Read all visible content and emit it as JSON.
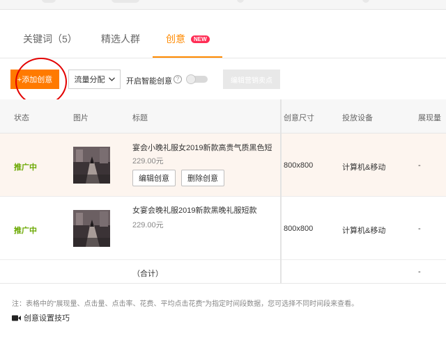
{
  "tabs": [
    {
      "label": "关键词（5）"
    },
    {
      "label": "精选人群"
    },
    {
      "label": "创意",
      "badge": "NEW"
    }
  ],
  "toolbar": {
    "add_label": "+添加创意",
    "distribution_label": "流量分配",
    "smart_label": "开启智能创意",
    "help_symbol": "?",
    "edit_selling_label": "编辑营销卖点"
  },
  "table": {
    "headers": [
      "状态",
      "图片",
      "标题",
      "创意尺寸",
      "投放设备",
      "展现量"
    ],
    "rows": [
      {
        "status": "推广中",
        "title": "宴会小晚礼服女2019新款高贵气质黑色短",
        "price": "229.00元",
        "size": "800x800",
        "device": "计算机&移动",
        "impressions": "-",
        "edit_label": "编辑创意",
        "delete_label": "删除创意"
      },
      {
        "status": "推广中",
        "title": "女宴会晚礼服2019新款黑晚礼服短款",
        "price": "229.00元",
        "size": "800x800",
        "device": "计算机&移动",
        "impressions": "-"
      }
    ],
    "total_label": "（合计）",
    "total_impressions": "-"
  },
  "note": "注：表格中的\"展现量、点击量、点击率、花费、平均点击花费\"为指定时间段数据，您可选择不同时间段来查看。",
  "tips_label": "创意设置技巧",
  "colors": {
    "accent": "#ff8a00",
    "status_green": "#6aa800",
    "badge_red": "#ff2d55"
  }
}
